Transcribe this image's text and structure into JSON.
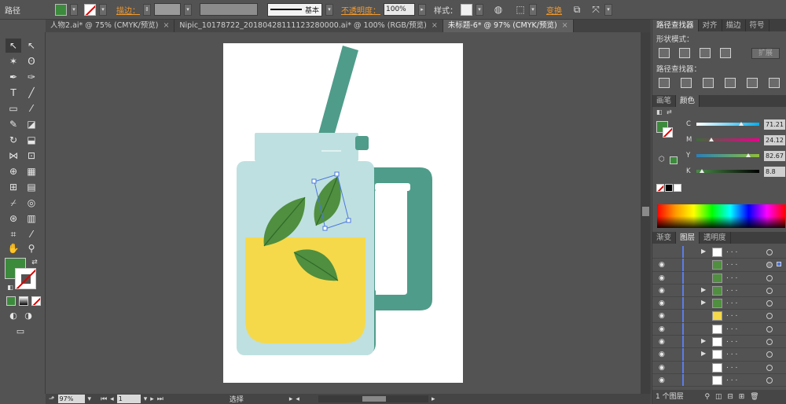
{
  "control_bar": {
    "object_type": "路径",
    "fill_color": "#3c8a3c",
    "stroke_label": "描边：",
    "stroke_profile": "基本",
    "opacity_label": "不透明度：",
    "opacity_value": "100%",
    "style_label": "样式：",
    "transform_label": "变换"
  },
  "tabs": [
    {
      "label": "人物2.ai* @ 75% (CMYK/预览)"
    },
    {
      "label": "Nipic_10178722_20180428111123280000.ai* @ 100% (RGB/预览)"
    },
    {
      "label": "未标题-6* @ 97% (CMYK/预览)"
    }
  ],
  "tab_close": "×",
  "status": {
    "zoom": "97%",
    "page": "1",
    "tool": "选择"
  },
  "pathfinder_panel": {
    "tabs": [
      "路径查找器",
      "对齐",
      "描边",
      "符号"
    ],
    "shape_modes_label": "形状模式：",
    "expand_label": "扩展",
    "pathfinders_label": "路径查找器："
  },
  "color_panel": {
    "tabs": [
      "画笔",
      "颜色"
    ],
    "channels": [
      {
        "name": "C",
        "value": "71.21",
        "level": 0.71,
        "color_from": "#ffffff",
        "color_to": "#00aeef"
      },
      {
        "name": "M",
        "value": "24.12",
        "level": 0.24,
        "color_from": "#3f6a3a",
        "color_to": "#ec008c"
      },
      {
        "name": "Y",
        "value": "82.67",
        "level": 0.83,
        "color_from": "#2b7fb8",
        "color_to": "#8fbf3a"
      },
      {
        "name": "K",
        "value": "8.8",
        "level": 0.09,
        "color_from": "#4a8a48",
        "color_to": "#000000"
      }
    ]
  },
  "layers_panel": {
    "tabs": [
      "渐变",
      "图层",
      "透明度"
    ],
    "rows": [
      {
        "eye": false,
        "arrow": true,
        "thumb": "#ffffff",
        "target": false
      },
      {
        "eye": true,
        "arrow": false,
        "thumb": "#4f8f3f",
        "target": true
      },
      {
        "eye": true,
        "arrow": false,
        "thumb": "#4f8f3f",
        "target": false
      },
      {
        "eye": true,
        "arrow": true,
        "thumb": "#4f8f3f",
        "target": false
      },
      {
        "eye": true,
        "arrow": true,
        "thumb": "#4f8f3f",
        "target": false
      },
      {
        "eye": true,
        "arrow": false,
        "thumb": "#f5d94a",
        "target": false
      },
      {
        "eye": true,
        "arrow": false,
        "thumb": "#ffffff",
        "target": false
      },
      {
        "eye": true,
        "arrow": true,
        "thumb": "#ffffff",
        "target": false
      },
      {
        "eye": true,
        "arrow": true,
        "thumb": "#ffffff",
        "target": false
      },
      {
        "eye": true,
        "arrow": false,
        "thumb": "#ffffff",
        "target": false
      },
      {
        "eye": true,
        "arrow": false,
        "thumb": "#ffffff",
        "target": false
      }
    ],
    "row_dots": ". . .",
    "footer": "1 个图层"
  }
}
